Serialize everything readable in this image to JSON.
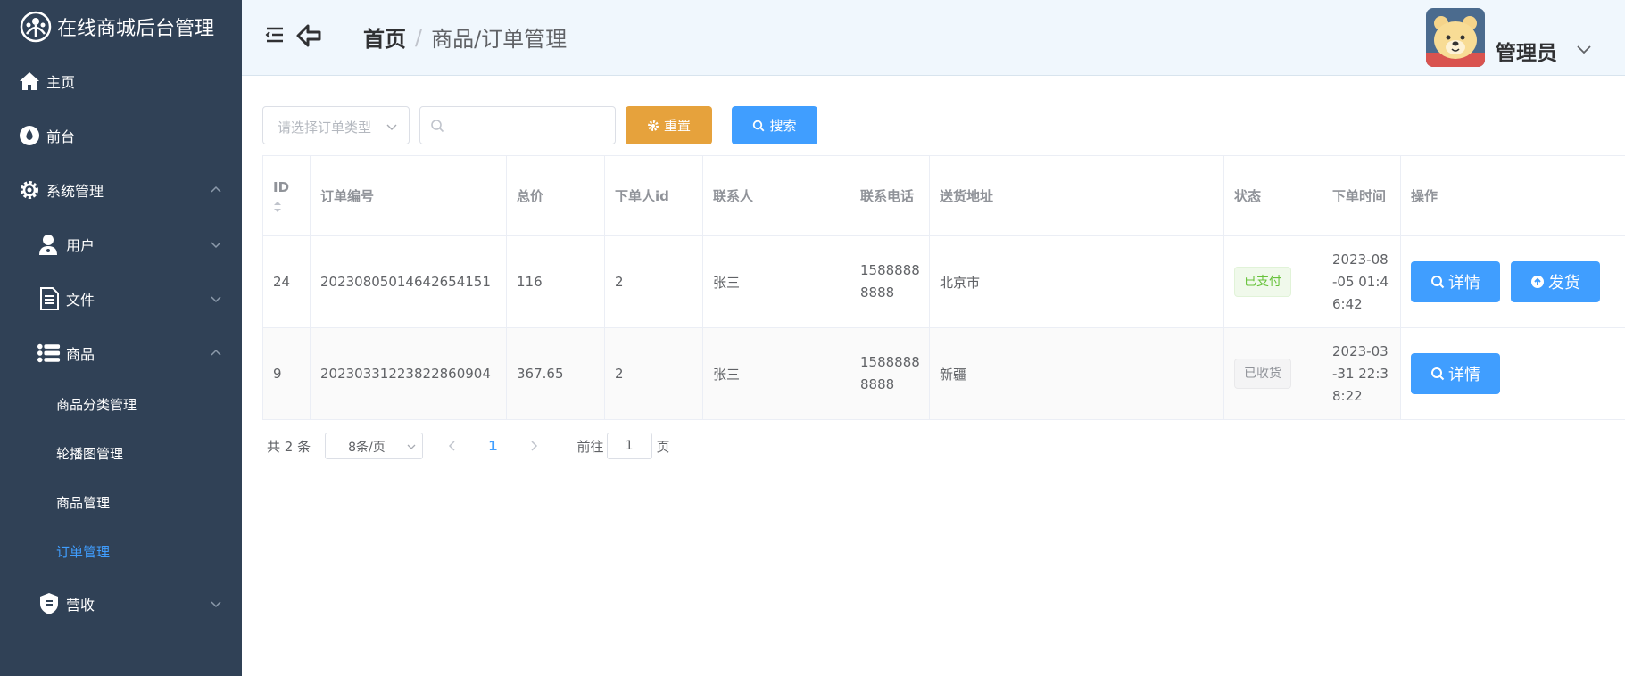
{
  "app": {
    "title": "在线商城后台管理"
  },
  "sidebar": {
    "items": [
      {
        "label": "主页",
        "icon": "home-icon"
      },
      {
        "label": "前台",
        "icon": "drop-icon"
      },
      {
        "label": "系统管理",
        "icon": "gear-icon",
        "expanded": true
      },
      {
        "label": "用户",
        "icon": "user-icon",
        "expanded": false
      },
      {
        "label": "文件",
        "icon": "document-icon",
        "expanded": false
      },
      {
        "label": "商品",
        "icon": "list-icon",
        "expanded": true
      },
      {
        "label": "营收",
        "icon": "badge-icon",
        "expanded": false
      }
    ],
    "goods_children": [
      "商品分类管理",
      "轮播图管理",
      "商品管理",
      "订单管理"
    ],
    "active": "订单管理"
  },
  "header": {
    "breadcrumb_home": "首页",
    "breadcrumb_sep": "/",
    "breadcrumb_current": "商品/订单管理",
    "user_name": "管理员"
  },
  "toolbar": {
    "type_placeholder": "请选择订单类型",
    "search_value": "",
    "reset_label": "重置",
    "search_label": "搜索"
  },
  "table": {
    "columns": [
      "ID",
      "订单编号",
      "总价",
      "下单人id",
      "联系人",
      "联系电话",
      "送货地址",
      "状态",
      "下单时间",
      "操作"
    ],
    "rows": [
      {
        "id": "24",
        "order_no": "20230805014642654151",
        "total": "116",
        "user_id": "2",
        "contact": "张三",
        "phone_1": "1588888",
        "phone_2": "8888",
        "address": "北京市",
        "status": "已支付",
        "time_1": "2023-08",
        "time_2": "-05 01:4",
        "time_3": "6:42",
        "detail_label": "详情",
        "ship_label": "发货"
      },
      {
        "id": "9",
        "order_no": "20230331223822860904",
        "total": "367.65",
        "user_id": "2",
        "contact": "张三",
        "phone_1": "1588888",
        "phone_2": "8888",
        "address": "新疆",
        "status": "已收货",
        "time_1": "2023-03",
        "time_2": "-31 22:3",
        "time_3": "8:22",
        "detail_label": "详情"
      }
    ]
  },
  "pagination": {
    "total_text": "共 2 条",
    "page_size": "8条/页",
    "current_page": "1",
    "goto_label": "前往",
    "goto_value": "1",
    "page_unit": "页"
  },
  "colors": {
    "sidebar_bg": "#304156",
    "active": "#409eff",
    "warning": "#e6a23c",
    "success": "#67c23a",
    "info": "#909399"
  }
}
